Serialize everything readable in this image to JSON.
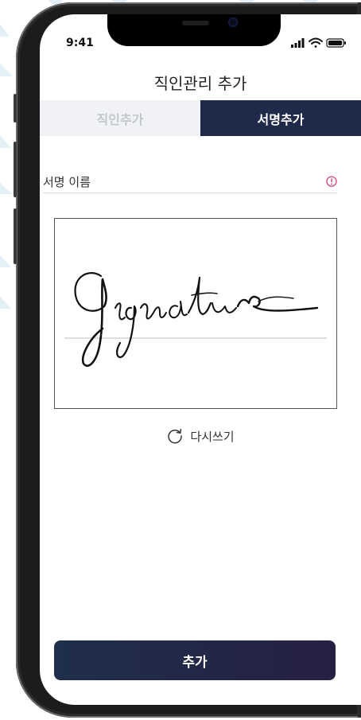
{
  "status_bar": {
    "time": "9:41"
  },
  "header": {
    "title": "직인관리 추가"
  },
  "tabs": [
    {
      "label": "직인추가",
      "active": false
    },
    {
      "label": "서명추가",
      "active": true
    }
  ],
  "form": {
    "signature_name_label": "서명 이름"
  },
  "signature_pad": {
    "redo_label": "다시쓰기"
  },
  "footer": {
    "add_label": "추가"
  },
  "colors": {
    "active_tab": "#1f2a4a",
    "inactive_tab": "#f0f2f5",
    "button": "#1f2f4d",
    "warning": "#d4437a"
  },
  "icons": [
    "signal-icon",
    "wifi-icon",
    "battery-icon",
    "warning-icon",
    "refresh-icon"
  ]
}
